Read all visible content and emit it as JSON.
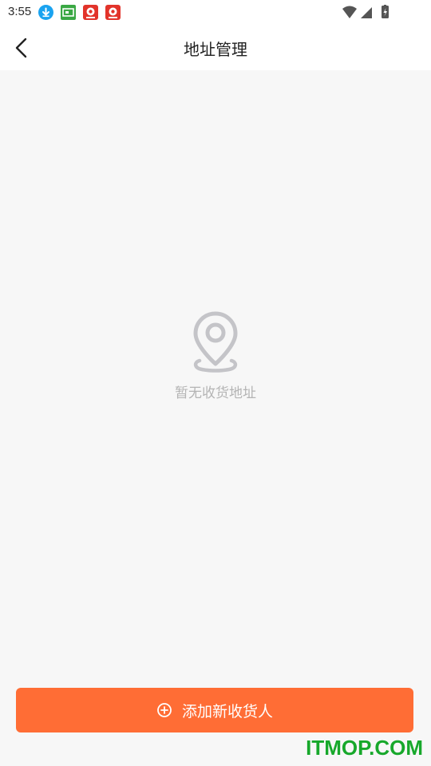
{
  "status_bar": {
    "time": "3:55",
    "notification_icons": [
      "download-icon",
      "green-app-icon",
      "red-app-icon",
      "red-app-icon"
    ],
    "system_icons": [
      "wifi-icon",
      "cell-signal-icon",
      "battery-charging-icon"
    ]
  },
  "header": {
    "back_icon": "chevron-left-icon",
    "title": "地址管理"
  },
  "empty_state": {
    "icon": "location-pin-icon",
    "text": "暂无收货地址"
  },
  "footer": {
    "add_button_icon": "plus-circle-icon",
    "add_button_label": "添加新收货人"
  },
  "watermark": "ITMOP.COM",
  "colors": {
    "accent": "#ff6d35",
    "background": "#f7f7f7",
    "empty_text": "#b4b4b4",
    "watermark": "#17a82b"
  }
}
